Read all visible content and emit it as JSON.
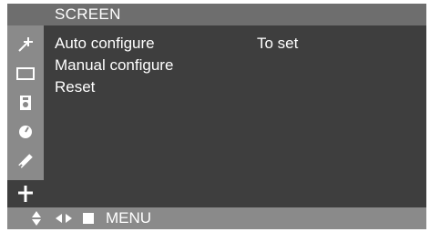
{
  "menu": {
    "title": "SCREEN",
    "items": [
      {
        "label": "Auto configure",
        "value": "To set"
      },
      {
        "label": "Manual configure"
      },
      {
        "label": "Reset"
      }
    ]
  },
  "sidebar": {
    "icons": [
      "brightness-icon",
      "display-icon",
      "color-icon",
      "clock-icon",
      "tracking-icon",
      "crosshair-icon"
    ],
    "selected": "crosshair-icon"
  },
  "footer": {
    "icons": [
      "up-down-icon",
      "left-right-icon",
      "square-icon"
    ],
    "menu_label": "MENU"
  },
  "colors": {
    "panel": "#3e3e3e",
    "header": "#6e6e6e",
    "sidebar": "#8a8a8a",
    "text": "#ffffff"
  }
}
